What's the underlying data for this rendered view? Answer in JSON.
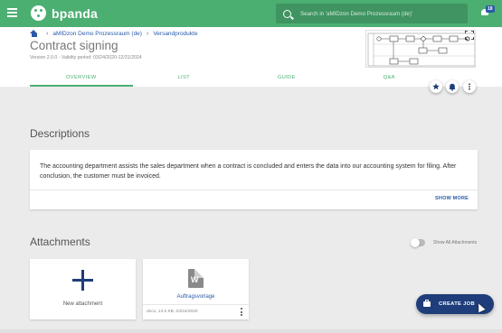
{
  "app": {
    "name": "bpanda",
    "search_placeholder": "Search in 'aMIDzon Demo Prozessraum (de)'",
    "notification_count": "18"
  },
  "breadcrumb": {
    "items": [
      "aMIDzon Demo Prozessraum (de)",
      "Versandprodukte"
    ]
  },
  "page": {
    "title": "Contract signing",
    "version": "Version 2.0.0 - Validity period: 03/24/2020-12/31/2024"
  },
  "tabs": [
    "OVERVIEW",
    "LIST",
    "GUIDE",
    "Q&A"
  ],
  "descriptions": {
    "title": "Descriptions",
    "text": "The accounting department assists the sales department when a contract is concluded and enters the data into our accounting system for filing. After conclusion, the customer must be invoiced.",
    "show_more": "SHOW MORE"
  },
  "attachments": {
    "title": "Attachments",
    "toggle_label": "Show All Attachments",
    "new_label": "New attachment",
    "file_name": "Auftragsvorlage",
    "file_meta": "docx, 13.5 KB, 03/24/2020"
  },
  "create_job_label": "CREATE JOB",
  "colors": {
    "brand_green": "#4caf72",
    "accent_blue": "#1e3d7a",
    "link_blue": "#2a5aa8"
  }
}
